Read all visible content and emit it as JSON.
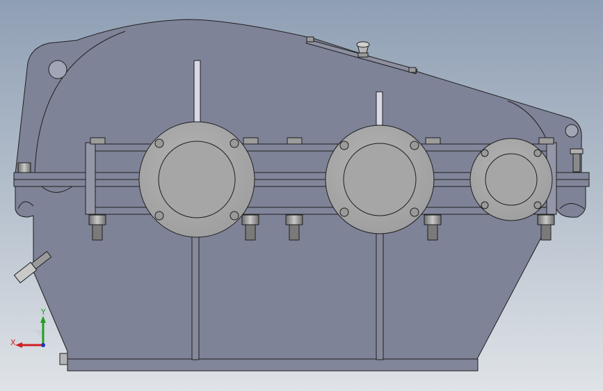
{
  "viewport": {
    "background_top": "#8f9fb4",
    "background_bottom": "#dfe3e7"
  },
  "model": {
    "housing_color": "#7f8397",
    "housing_dark": "#6f7387",
    "cover_color": "#a9a9a9",
    "bolt_color": "#8a8a8a",
    "shaft_color": "#d8d8e8",
    "outline_color": "#1e1e1e"
  },
  "triad": {
    "x_label": "X",
    "y_label": "Y",
    "x_color": "#d02020",
    "y_color": "#20a020",
    "z_color": "#2030c0"
  }
}
